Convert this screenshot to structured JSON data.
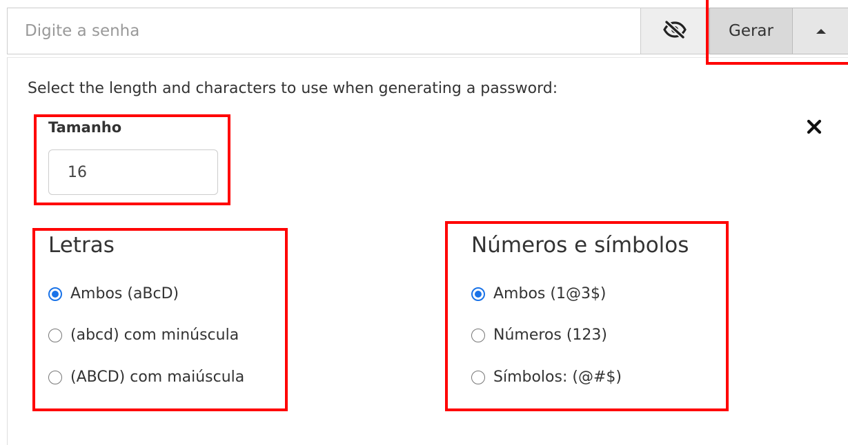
{
  "password": {
    "placeholder": "Digite a senha",
    "value": "",
    "toggle_icon": "eye-slash-icon",
    "generate_label": "Gerar",
    "menu_icon": "caret-up-icon"
  },
  "generator": {
    "instruction": "Select the length and characters to use when generating a password:",
    "close_icon": "close-icon",
    "size": {
      "label": "Tamanho",
      "value": "16"
    },
    "letters": {
      "title": "Letras",
      "options": [
        {
          "label": "Ambos (aBcD)",
          "selected": true
        },
        {
          "label": "(abcd) com minúscula",
          "selected": false
        },
        {
          "label": "(ABCD) com maiúscula",
          "selected": false
        }
      ]
    },
    "numbers_symbols": {
      "title": "Números e símbolos",
      "options": [
        {
          "label": "Ambos (1@3$)",
          "selected": true
        },
        {
          "label": "Números (123)",
          "selected": false
        },
        {
          "label": "Símbolos: (@#$)",
          "selected": false
        }
      ]
    }
  },
  "colors": {
    "highlight": "#ff0000",
    "radio_selected": "#1a73e8"
  }
}
